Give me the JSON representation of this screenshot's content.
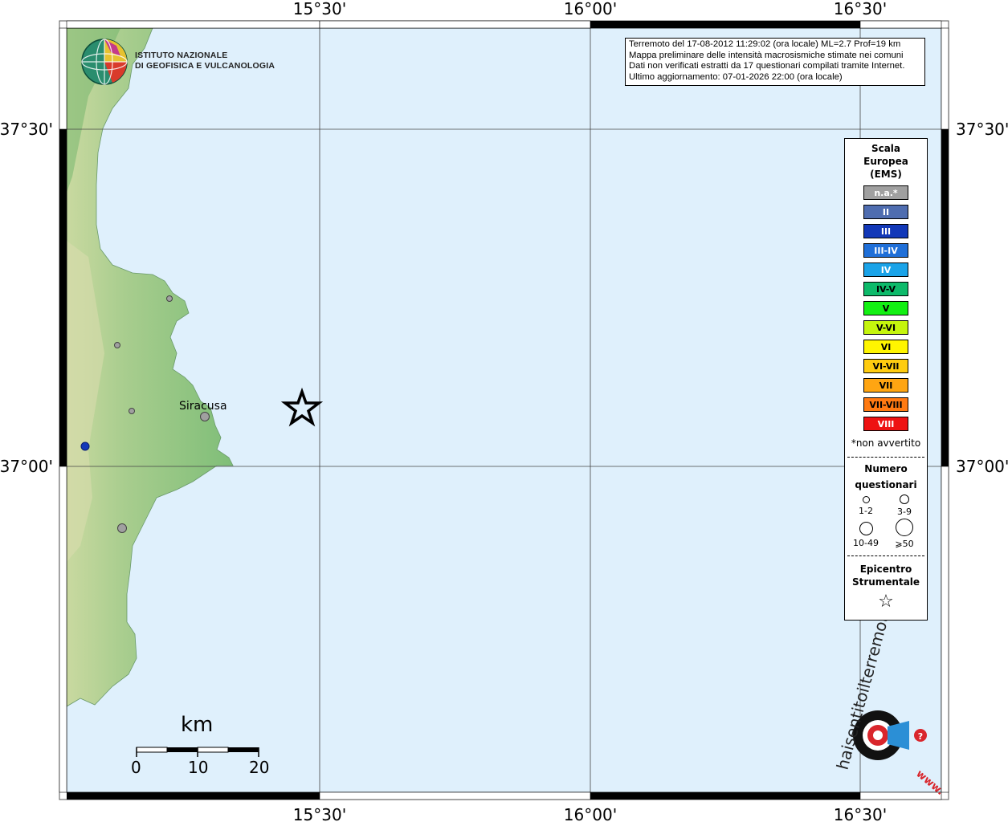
{
  "map": {
    "sea_color": "#dff0fc",
    "land_color": "#93c486",
    "top_lon_labels": [
      "15°30'",
      "16°00'",
      "16°30'"
    ],
    "bottom_lon_labels": [
      "15°30'",
      "16°00'",
      "16°30'"
    ],
    "left_lat_labels": [
      "37°30'",
      "37°00'"
    ],
    "right_lat_labels": [
      "37°30'",
      "37°00'"
    ]
  },
  "logo": {
    "line1": "ISTITUTO NAZIONALE",
    "line2": "DI GEOFISICA E VULCANOLOGIA"
  },
  "info_box": {
    "line1": "Terremoto del 17-08-2012 11:29:02 (ora locale) ML=2.7 Prof=19 km",
    "line2": "Mappa preliminare delle intensità macrosismiche stimate nei comuni",
    "line3": "Dati non verificati estratti da 17 questionari compilati tramite Internet.",
    "line4": "Ultimo aggiornamento: 07-01-2026 22:00 (ora locale)"
  },
  "legend": {
    "title_line1": "Scala",
    "title_line2": "Europea",
    "title_line3": "(EMS)",
    "ems": [
      {
        "label": "n.a.*",
        "color": "#a0a0a0",
        "text_color": "#ffffff"
      },
      {
        "label": "II",
        "color": "#4f6db0",
        "text_color": "#ffffff"
      },
      {
        "label": "III",
        "color": "#1238b8",
        "text_color": "#ffffff"
      },
      {
        "label": "III-IV",
        "color": "#1f6fd8",
        "text_color": "#ffffff"
      },
      {
        "label": "IV",
        "color": "#1aa3e8",
        "text_color": "#ffffff"
      },
      {
        "label": "IV-V",
        "color": "#0dba6a",
        "text_color": "#000000"
      },
      {
        "label": "V",
        "color": "#13f013",
        "text_color": "#000000"
      },
      {
        "label": "V-VI",
        "color": "#c5f50d",
        "text_color": "#000000"
      },
      {
        "label": "VI",
        "color": "#fff500",
        "text_color": "#000000"
      },
      {
        "label": "VI-VII",
        "color": "#ffcc10",
        "text_color": "#000000"
      },
      {
        "label": "VII",
        "color": "#ffa512",
        "text_color": "#000000"
      },
      {
        "label": "VII-VIII",
        "color": "#ff7a12",
        "text_color": "#000000"
      },
      {
        "label": "VIII",
        "color": "#ee1212",
        "text_color": "#ffffff"
      }
    ],
    "note": "*non avvertito",
    "count_title_line1": "Numero",
    "count_title_line2": "questionari",
    "counts": [
      "1-2",
      "3-9",
      "10-49",
      "⩾50"
    ],
    "epicenter_title_line1": "Epicentro",
    "epicenter_title_line2": "Strumentale",
    "epicenter_symbol": "☆"
  },
  "places": [
    {
      "name": "Siracusa"
    }
  ],
  "scale_bar": {
    "unit": "km",
    "ticks": [
      "0",
      "10",
      "20"
    ]
  },
  "watermark": {
    "text": "haisentitoilterremoto.it",
    "prefix": "www."
  }
}
